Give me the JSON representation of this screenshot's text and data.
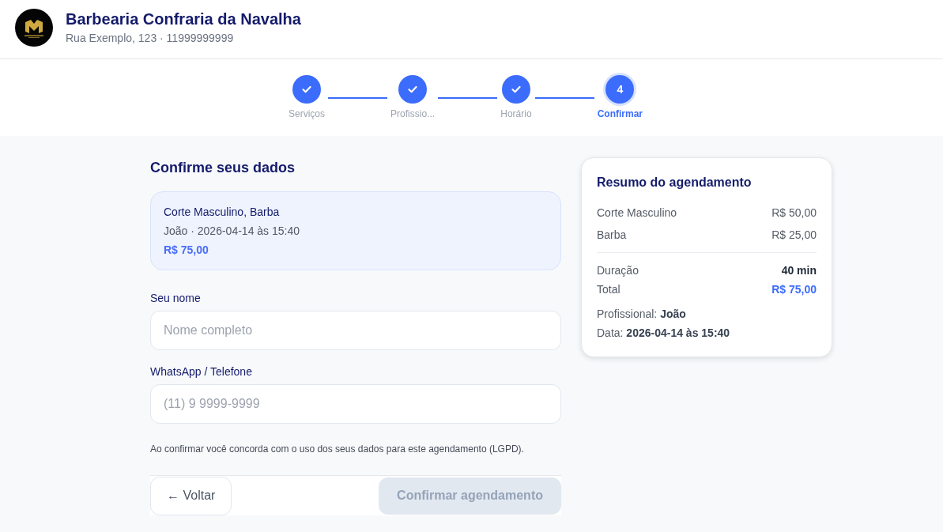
{
  "header": {
    "title": "Barbearia Confraria da Navalha",
    "subtitle": "Rua Exemplo, 123 · 11999999999"
  },
  "steps": [
    {
      "label": "Serviços",
      "completed": true,
      "selected": false
    },
    {
      "label": "Profissio...",
      "completed": true,
      "selected": false
    },
    {
      "label": "Horário",
      "completed": true,
      "selected": false
    },
    {
      "label": "Confirmar",
      "completed": false,
      "selected": true,
      "number": "4"
    }
  ],
  "form": {
    "title": "Confirme seus dados",
    "booking": {
      "services": "Corte Masculino, Barba",
      "details": "João · 2026-04-14 às 15:40",
      "price": "R$ 75,00"
    },
    "fields": [
      {
        "label": "Seu nome",
        "placeholder": "Nome completo"
      },
      {
        "label": "WhatsApp / Telefone",
        "placeholder": "(11) 9 9999-9999"
      }
    ],
    "consent": "Ao confirmar você concorda com o uso dos seus dados para este agendamento (LGPD).",
    "buttons": [
      {
        "label": "← Voltar",
        "kind": "back",
        "disabled": false
      },
      {
        "label": "Confirmar agendamento",
        "kind": "primary",
        "disabled": true
      }
    ]
  },
  "summary": {
    "title": "Resumo do agendamento",
    "items": [
      {
        "name": "Corte Masculino",
        "price": "R$ 50,00"
      },
      {
        "name": "Barba",
        "price": "R$ 25,00"
      }
    ],
    "totals": [
      {
        "label": "Duração",
        "value": "40 min",
        "kind": "plain"
      },
      {
        "label": "Total",
        "value": "R$ 75,00",
        "kind": "accent"
      }
    ],
    "details": [
      "Profissional: **João**",
      "Data: **2026-04-14 às 15:40**"
    ]
  }
}
